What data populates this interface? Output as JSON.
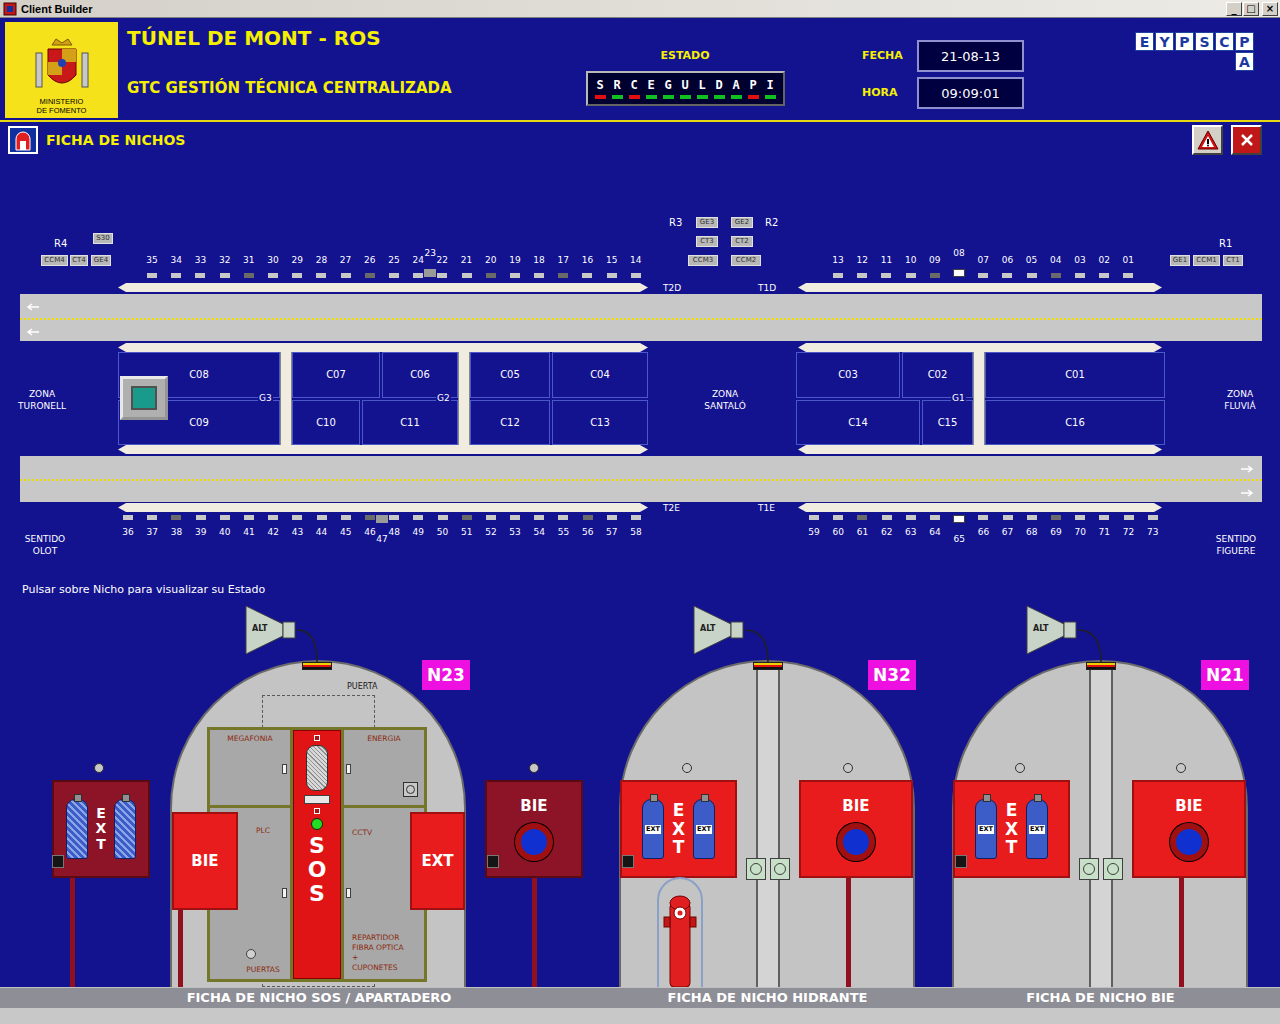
{
  "window": {
    "title": "Client Builder",
    "controls": [
      "_",
      "□",
      "×"
    ]
  },
  "header": {
    "ministry": [
      "MINISTERIO",
      "DE FOMENTO"
    ],
    "title": "TÚNEL DE MONT - ROS",
    "subtitle": "GTC GESTIÓN TÉCNICA CENTRALIZADA",
    "status": {
      "label": "ESTADO",
      "signals": [
        {
          "letter": "S",
          "color": "#e01010"
        },
        {
          "letter": "R",
          "color": "#10c020"
        },
        {
          "letter": "C",
          "color": "#e01010"
        },
        {
          "letter": "E",
          "color": "#10c020"
        },
        {
          "letter": "G",
          "color": "#10c020"
        },
        {
          "letter": "U",
          "color": "#10c020"
        },
        {
          "letter": "L",
          "color": "#10c020"
        },
        {
          "letter": "D",
          "color": "#10c020"
        },
        {
          "letter": "A",
          "color": "#10c020"
        },
        {
          "letter": "P",
          "color": "#e01010"
        },
        {
          "letter": "I",
          "color": "#10c020"
        }
      ]
    },
    "date": {
      "label": "FECHA",
      "value": "21-08-13"
    },
    "time": {
      "label": "HORA",
      "value": "09:09:01"
    },
    "brand": {
      "top": [
        "E",
        "Y",
        "P",
        "S",
        "C",
        "P"
      ],
      "bottom": "A"
    }
  },
  "section": {
    "title": "FICHA DE NICHOS"
  },
  "diagram": {
    "rooms": [
      "R4",
      "R3",
      "R2",
      "R1"
    ],
    "equipment": [
      "S30",
      "CCM4",
      "CT4",
      "GE4",
      "GE3",
      "CT3",
      "CCM3",
      "GE2",
      "CT2",
      "CCM2",
      "GE1",
      "CCM1",
      "CT1"
    ],
    "tubes": [
      "T2D",
      "T1D",
      "T2E",
      "T1E"
    ],
    "galleries": [
      "G3",
      "G2",
      "G1"
    ],
    "cells": [
      "C08",
      "C07",
      "C06",
      "C05",
      "C04",
      "C09",
      "C10",
      "C11",
      "C12",
      "C13",
      "C03",
      "C02",
      "C01",
      "C14",
      "C15",
      "C16"
    ],
    "zones": [
      {
        "lines": [
          "ZONA",
          "TURONELL"
        ]
      },
      {
        "lines": [
          "ZONA",
          "SANTALÓ"
        ]
      },
      {
        "lines": [
          "ZONA",
          "FLUVIÁ"
        ]
      }
    ],
    "directions": [
      {
        "lines": [
          "SENTIDO",
          "OLOT"
        ]
      },
      {
        "lines": [
          "SENTIDO",
          "FIGUERE"
        ]
      }
    ],
    "niche_rows": {
      "upper_left": [
        {
          "number": "35",
          "kind": "normal",
          "color": "#c8c8c8"
        },
        {
          "number": "34",
          "kind": "normal",
          "color": "#c8c8c8"
        },
        {
          "number": "33",
          "kind": "normal",
          "color": "#c8c8c8"
        },
        {
          "number": "32",
          "kind": "normal",
          "color": "#c8c8c8"
        },
        {
          "number": "31",
          "kind": "normal",
          "color": "#6a6a6a"
        },
        {
          "number": "30",
          "kind": "normal",
          "color": "#c8c8c8"
        },
        {
          "number": "29",
          "kind": "normal",
          "color": "#c8c8c8"
        },
        {
          "number": "28",
          "kind": "normal",
          "color": "#c8c8c8"
        },
        {
          "number": "27",
          "kind": "normal",
          "color": "#c8c8c8"
        },
        {
          "number": "26",
          "kind": "normal",
          "color": "#6a6a6a"
        },
        {
          "number": "25",
          "kind": "normal",
          "color": "#c8c8c8"
        },
        {
          "number": "24",
          "kind": "normal",
          "color": "#c8c8c8"
        },
        {
          "number": "23",
          "kind": "between",
          "color": "#9a9a9a"
        },
        {
          "number": "22",
          "kind": "normal",
          "color": "#c8c8c8"
        },
        {
          "number": "21",
          "kind": "normal",
          "color": "#c8c8c8"
        },
        {
          "number": "20",
          "kind": "normal",
          "color": "#6a6a6a"
        },
        {
          "number": "19",
          "kind": "normal",
          "color": "#c8c8c8"
        },
        {
          "number": "18",
          "kind": "normal",
          "color": "#c8c8c8"
        },
        {
          "number": "17",
          "kind": "normal",
          "color": "#6a6a6a"
        },
        {
          "number": "16",
          "kind": "normal",
          "color": "#c8c8c8"
        },
        {
          "number": "15",
          "kind": "normal",
          "color": "#c8c8c8"
        },
        {
          "number": "14",
          "kind": "normal",
          "color": "#c8c8c8"
        }
      ],
      "upper_right": [
        {
          "number": "13",
          "kind": "normal",
          "color": "#c8c8c8"
        },
        {
          "number": "12",
          "kind": "normal",
          "color": "#c8c8c8"
        },
        {
          "number": "11",
          "kind": "normal",
          "color": "#c8c8c8"
        },
        {
          "number": "10",
          "kind": "normal",
          "color": "#c8c8c8"
        },
        {
          "number": "09",
          "kind": "normal",
          "color": "#6a6a6a"
        },
        {
          "number": "08",
          "kind": "wide",
          "color": "#ffffff"
        },
        {
          "number": "07",
          "kind": "normal",
          "color": "#c8c8c8"
        },
        {
          "number": "06",
          "kind": "normal",
          "color": "#c8c8c8"
        },
        {
          "number": "05",
          "kind": "normal",
          "color": "#c8c8c8"
        },
        {
          "number": "04",
          "kind": "normal",
          "color": "#6a6a6a"
        },
        {
          "number": "03",
          "kind": "normal",
          "color": "#c8c8c8"
        },
        {
          "number": "02",
          "kind": "normal",
          "color": "#c8c8c8"
        },
        {
          "number": "01",
          "kind": "normal",
          "color": "#c8c8c8"
        }
      ],
      "lower_left": [
        {
          "number": "36",
          "kind": "normal",
          "color": "#c8c8c8"
        },
        {
          "number": "37",
          "kind": "normal",
          "color": "#c8c8c8"
        },
        {
          "number": "38",
          "kind": "normal",
          "color": "#6a6a6a"
        },
        {
          "number": "39",
          "kind": "normal",
          "color": "#c8c8c8"
        },
        {
          "number": "40",
          "kind": "normal",
          "color": "#c8c8c8"
        },
        {
          "number": "41",
          "kind": "normal",
          "color": "#c8c8c8"
        },
        {
          "number": "42",
          "kind": "normal",
          "color": "#c8c8c8"
        },
        {
          "number": "43",
          "kind": "normal",
          "color": "#c8c8c8"
        },
        {
          "number": "44",
          "kind": "normal",
          "color": "#c8c8c8"
        },
        {
          "number": "45",
          "kind": "normal",
          "color": "#c8c8c8"
        },
        {
          "number": "46",
          "kind": "normal",
          "color": "#6a6a6a"
        },
        {
          "number": "47",
          "kind": "between",
          "color": "#9a9a9a"
        },
        {
          "number": "48",
          "kind": "normal",
          "color": "#c8c8c8"
        },
        {
          "number": "49",
          "kind": "normal",
          "color": "#c8c8c8"
        },
        {
          "number": "50",
          "kind": "normal",
          "color": "#c8c8c8"
        },
        {
          "number": "51",
          "kind": "normal",
          "color": "#6a6a6a"
        },
        {
          "number": "52",
          "kind": "normal",
          "color": "#c8c8c8"
        },
        {
          "number": "53",
          "kind": "normal",
          "color": "#c8c8c8"
        },
        {
          "number": "54",
          "kind": "normal",
          "color": "#c8c8c8"
        },
        {
          "number": "55",
          "kind": "normal",
          "color": "#c8c8c8"
        },
        {
          "number": "56",
          "kind": "normal",
          "color": "#6a6a6a"
        },
        {
          "number": "57",
          "kind": "normal",
          "color": "#c8c8c8"
        },
        {
          "number": "58",
          "kind": "normal",
          "color": "#c8c8c8"
        }
      ],
      "lower_right": [
        {
          "number": "59",
          "kind": "normal",
          "color": "#c8c8c8"
        },
        {
          "number": "60",
          "kind": "normal",
          "color": "#c8c8c8"
        },
        {
          "number": "61",
          "kind": "normal",
          "color": "#6a6a6a"
        },
        {
          "number": "62",
          "kind": "normal",
          "color": "#c8c8c8"
        },
        {
          "number": "63",
          "kind": "normal",
          "color": "#c8c8c8"
        },
        {
          "number": "64",
          "kind": "normal",
          "color": "#c8c8c8"
        },
        {
          "number": "65",
          "kind": "wide",
          "color": "#ffffff"
        },
        {
          "number": "66",
          "kind": "normal",
          "color": "#c8c8c8"
        },
        {
          "number": "67",
          "kind": "normal",
          "color": "#c8c8c8"
        },
        {
          "number": "68",
          "kind": "normal",
          "color": "#c8c8c8"
        },
        {
          "number": "69",
          "kind": "normal",
          "color": "#6a6a6a"
        },
        {
          "number": "70",
          "kind": "normal",
          "color": "#c8c8c8"
        },
        {
          "number": "71",
          "kind": "normal",
          "color": "#c8c8c8"
        },
        {
          "number": "72",
          "kind": "normal",
          "color": "#c8c8c8"
        },
        {
          "number": "73",
          "kind": "normal",
          "color": "#c8c8c8"
        }
      ]
    }
  },
  "hint": "Pulsar sobre Nicho para visualizar su Estado",
  "niches": [
    {
      "badge": "N23",
      "kind": "sos",
      "speaker": "ALT",
      "door": "PUERTA",
      "cabinet": {
        "megafonia": "MEGAFONIA",
        "plc": "PLC",
        "puertas": "PUERTAS",
        "energia": "ENERGIA",
        "cctv": "CCTV",
        "repartidor": "REPARTIDOR",
        "fibra": [
          "FIBRA OPTICA",
          "+",
          "CUPONETES"
        ],
        "sos": "SOS",
        "sos_light_on": true
      },
      "bie": "BIE",
      "ext": "EXT",
      "outer_ext": "EXT",
      "outer_bie": "BIE"
    },
    {
      "badge": "N32",
      "kind": "hidrante",
      "speaker": "ALT",
      "ext": "EXT",
      "bottle_label": "EXT",
      "bie": "BIE"
    },
    {
      "badge": "N21",
      "kind": "bie",
      "speaker": "ALT",
      "ext": "EXT",
      "bottle_label": "EXT",
      "bie": "BIE"
    }
  ],
  "footer": [
    "FICHA DE NICHO SOS / APARTADERO",
    "FICHA DE NICHO HIDRANTE",
    "FICHA DE NICHO BIE"
  ]
}
